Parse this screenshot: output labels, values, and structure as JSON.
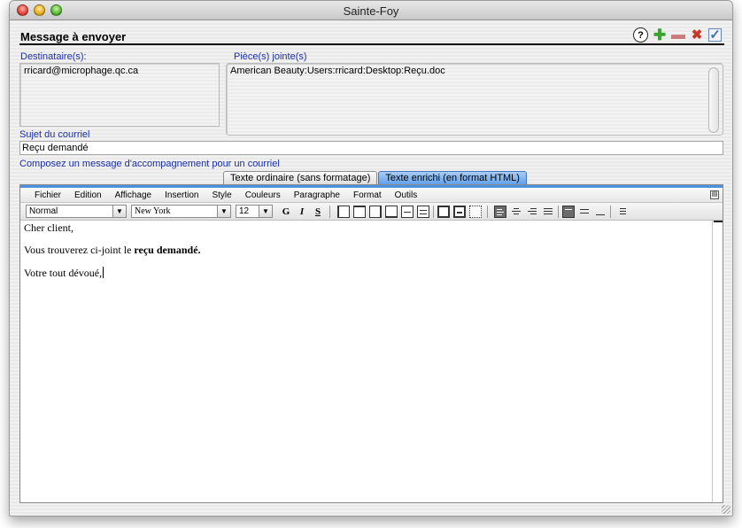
{
  "window": {
    "title": "Sainte-Foy"
  },
  "form": {
    "title": "Message à envoyer",
    "recipients_label": "Destinataire(s):",
    "recipients_value": "rricard@microphage.qc.ca",
    "attachments_label": "Pièce(s) jointe(s)",
    "attachments_value": "American Beauty:Users:rricard:Desktop:Reçu.doc",
    "subject_label": "Sujet du courriel",
    "subject_value": "Reçu demandé",
    "compose_label": "Composez un message d'accompagnement pour un courriel"
  },
  "header_icons": [
    "help-icon",
    "add-icon",
    "remove-icon",
    "delete-icon",
    "validate-icon"
  ],
  "tabs": [
    {
      "label": "Texte ordinaire (sans formatage)",
      "active": false
    },
    {
      "label": "Texte enrichi (en format HTML)",
      "active": true
    }
  ],
  "editor": {
    "menu": [
      "Fichier",
      "Edition",
      "Affichage",
      "Insertion",
      "Style",
      "Couleurs",
      "Paragraphe",
      "Format",
      "Outils"
    ],
    "style_select": "Normal",
    "font_select": "New York",
    "size_select": "12",
    "bold_label": "G",
    "italic_label": "I",
    "underline_label": "S",
    "content": {
      "greeting": "Cher client,",
      "line2_prefix": "Vous trouverez ci-joint le ",
      "line2_bold": "reçu demandé.",
      "closing": "Votre tout dévoué,"
    }
  },
  "colors": {
    "label_blue": "#1c2fa6",
    "active_tab": "#5c9de8"
  }
}
